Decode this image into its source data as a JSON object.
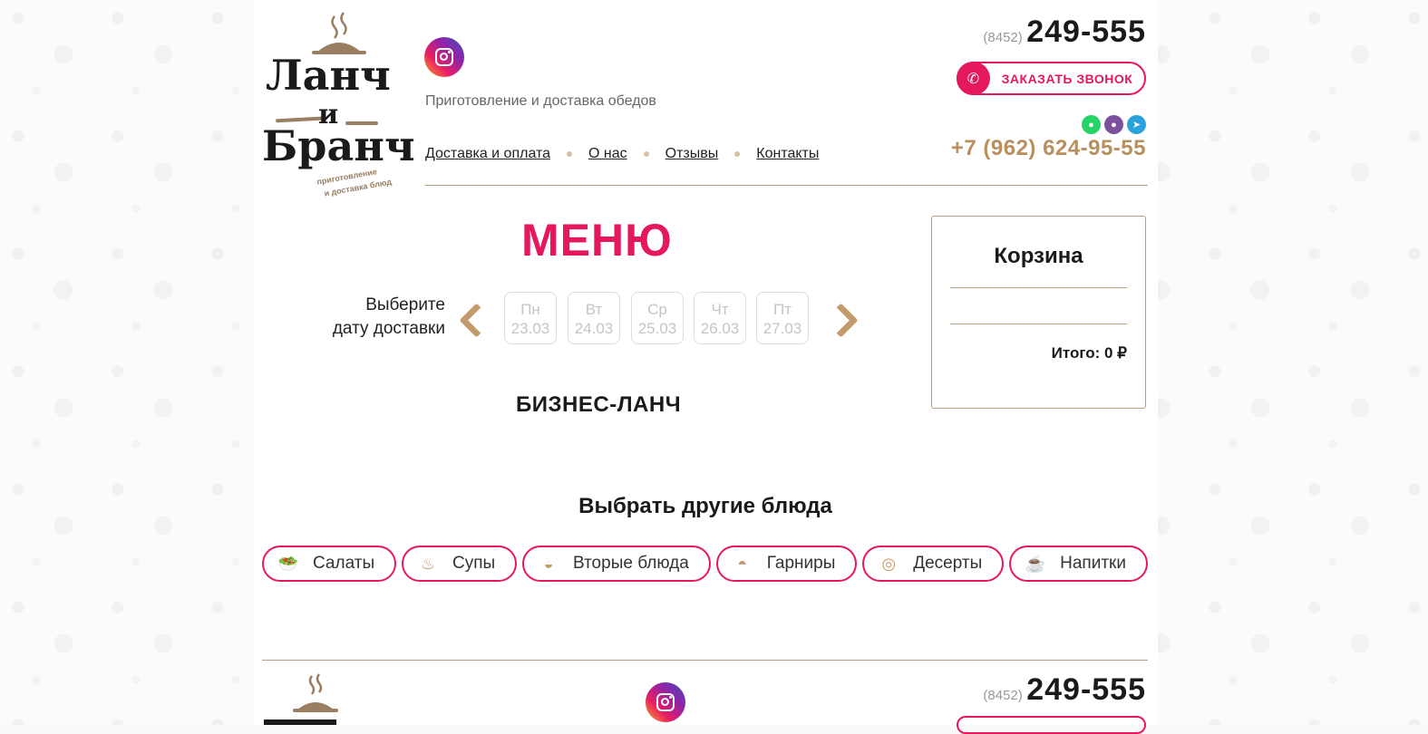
{
  "logo": {
    "line1": "Ланч",
    "line2": "и",
    "line3": "Бранч",
    "sub1": "приготовление",
    "sub2": "и доставка блюд"
  },
  "header": {
    "tagline": "Приготовление и доставка обедов",
    "nav": [
      "Доставка и оплата",
      "О нас",
      "Отзывы",
      "Контакты"
    ],
    "phone_code": "(8452)",
    "phone_number": "249-555",
    "call_button": "ЗАКАЗАТЬ ЗВОНОК",
    "mobile": "+7 (962) 624-95-55",
    "messengers": [
      "whatsapp-icon",
      "viber-icon",
      "telegram-icon"
    ]
  },
  "menu": {
    "title": "МЕНЮ",
    "choose_date_line1": "Выберите",
    "choose_date_line2": "дату доставки",
    "days": [
      {
        "dow": "Пн",
        "date": "23.03"
      },
      {
        "dow": "Вт",
        "date": "24.03"
      },
      {
        "dow": "Ср",
        "date": "25.03"
      },
      {
        "dow": "Чт",
        "date": "26.03"
      },
      {
        "dow": "Пт",
        "date": "27.03"
      }
    ],
    "section": "БИЗНЕС-ЛАНЧ"
  },
  "cart": {
    "title": "Корзина",
    "total": "Итого: 0 ₽"
  },
  "categories": {
    "title": "Выбрать другие блюда",
    "items": [
      {
        "label": "Салаты",
        "icon": "salad-icon"
      },
      {
        "label": "Супы",
        "icon": "soup-icon"
      },
      {
        "label": "Вторые блюда",
        "icon": "main-dish-icon"
      },
      {
        "label": "Гарниры",
        "icon": "garnish-icon"
      },
      {
        "label": "Десерты",
        "icon": "dessert-icon"
      },
      {
        "label": "Напитки",
        "icon": "drinks-icon"
      }
    ]
  },
  "footer": {
    "phone_code": "(8452)",
    "phone_number": "249-555"
  },
  "colors": {
    "accent": "#e5185d",
    "brown": "#b88f5e",
    "line": "#b8a082"
  }
}
